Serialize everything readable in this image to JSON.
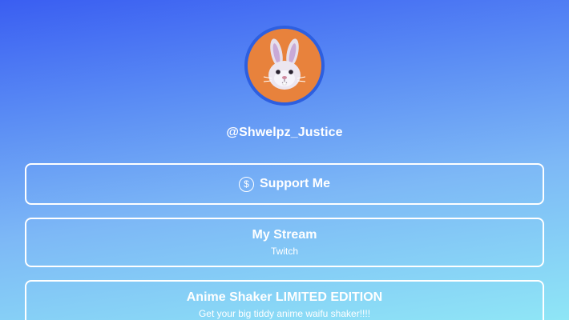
{
  "profile": {
    "handle": "@Shwelpz_Justice",
    "avatar_icon": "bunny-face-icon"
  },
  "links": [
    {
      "title": "Support Me",
      "subtitle": "",
      "icon": "dollar-circle-icon"
    },
    {
      "title": "My Stream",
      "subtitle": "Twitch"
    },
    {
      "title": "Anime Shaker LIMITED EDITION",
      "subtitle": "Get your big tiddy anime waifu shaker!!!!"
    }
  ],
  "colors": {
    "gradient_top": "#3a5ef2",
    "gradient_bottom": "#8fe6f6",
    "avatar_bg": "#e8823c",
    "avatar_ring": "#2d5fe0"
  }
}
